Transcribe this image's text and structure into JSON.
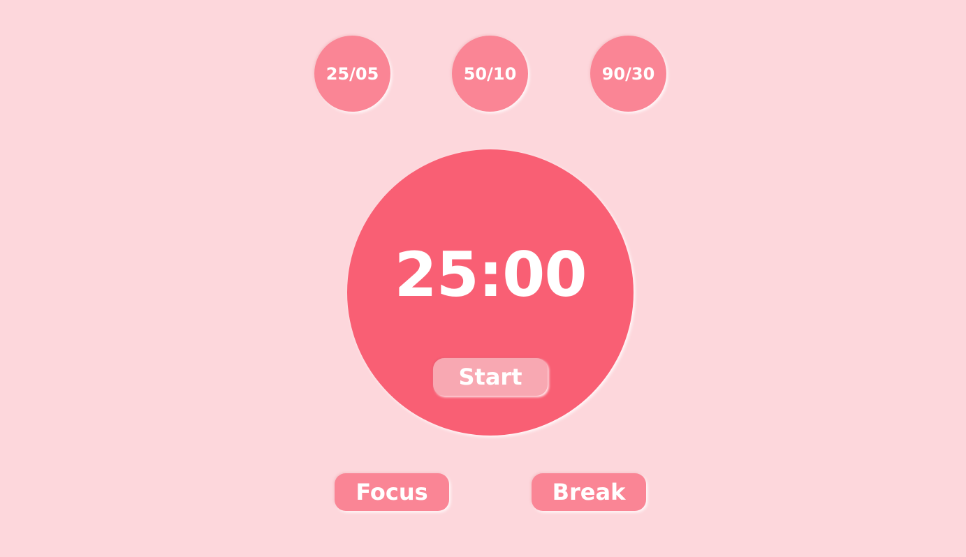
{
  "presets": [
    {
      "label": "25/05"
    },
    {
      "label": "50/10"
    },
    {
      "label": "90/30"
    }
  ],
  "timer": {
    "display": "25:00",
    "start_label": "Start"
  },
  "modes": [
    {
      "label": "Focus"
    },
    {
      "label": "Break"
    }
  ],
  "colors": {
    "background": "#fdd7dc",
    "preset_button": "#fa8595",
    "timer_circle": "#f95f74",
    "start_button": "#f8a8b2",
    "text": "#ffffff"
  }
}
